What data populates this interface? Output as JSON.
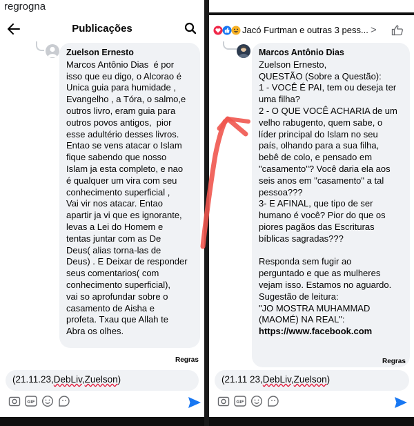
{
  "top_caption": "regrogna",
  "left": {
    "header_title": "Publicações",
    "comment": {
      "author": "Zuelson Ernesto",
      "body": "Marcos Antônio Dias  é por\nisso que eu digo, o Alcorao é\nUnica guia para humidade ,\nEvangelho , a Tóra, o salmo,e\noutros livro, eram guia para\noutros povos antigos,  pior\nesse adultério desses livros.\nEntao se vens atacar o Islam\nfique sabendo que nosso\nIslam ja esta completo, e nao\né qualquer um vira com seu\nconhecimento superficial ,\nVai vir nos atacar. Entao\napartir ja vi que es ignorante,\nlevas a Lei do Homem e\ntentas juntar com as De\nDeus( alias torna-las de\nDeus) . E Deixar de responder\nseus comentarios( com\nconhecimento superficial),\nvai so aprofundar sobre o\ncasamento de Aisha e\nprofeta. Txau que Allah te\nAbra os olhes."
    },
    "regras": "Regras",
    "composer": {
      "prefix": "(21.11.23,",
      "name1": "DebLiv",
      "sep": ",",
      "name2": "Zuelson",
      "suffix": ")"
    }
  },
  "right": {
    "header_title": "Jacó Furtman e outras 3 pess...",
    "chevron": ">",
    "comment": {
      "author": "Marcos Antônio Dias",
      "body": "Zuelson Ernesto,\nQUESTÃO (Sobre a Questão):\n1 - VOCÊ É PAI, tem ou deseja ter\numa filha?\n2 - O QUE VOCÊ ACHARIA de um\nvelho rabugento, quem sabe, o\nlíder principal do Islam no seu\npaís, olhando para a sua filha,\nbebê de colo, e pensado em\n\"casamento\"? Você daria ela aos\nseis anos em \"casamento\" a tal\npessoa???\n3- E AFINAL, que tipo de ser\nhumano é você? Pior do que os\npiores pagãos das Escrituras\nbíblicas sagradas???\n\nResponda sem fugir ao\nperguntado e que as mulheres\nvejam isso. Estamos no aguardo.\nSugestão de leitura:\n\"JO MOSTRA MUHAMMAD\n(MAOMÉ) NA REAL\":",
      "link": "https://www.facebook.com"
    },
    "regras": "Regras",
    "composer": {
      "prefix": "(21.11 23,",
      "name1": "DebLiv",
      "sep": ",",
      "name2": "Zuelson",
      "suffix": ")"
    }
  },
  "colors": {
    "bubble": "#f0f2f5",
    "send": "#1877f2",
    "annotation_arrow": "#f0564f",
    "spellcheck": "#e41e3f"
  },
  "icons": [
    "back-arrow-icon",
    "search-icon",
    "like-icon",
    "camera-icon",
    "gif-icon",
    "emoji-icon",
    "sticker-icon",
    "send-icon"
  ]
}
